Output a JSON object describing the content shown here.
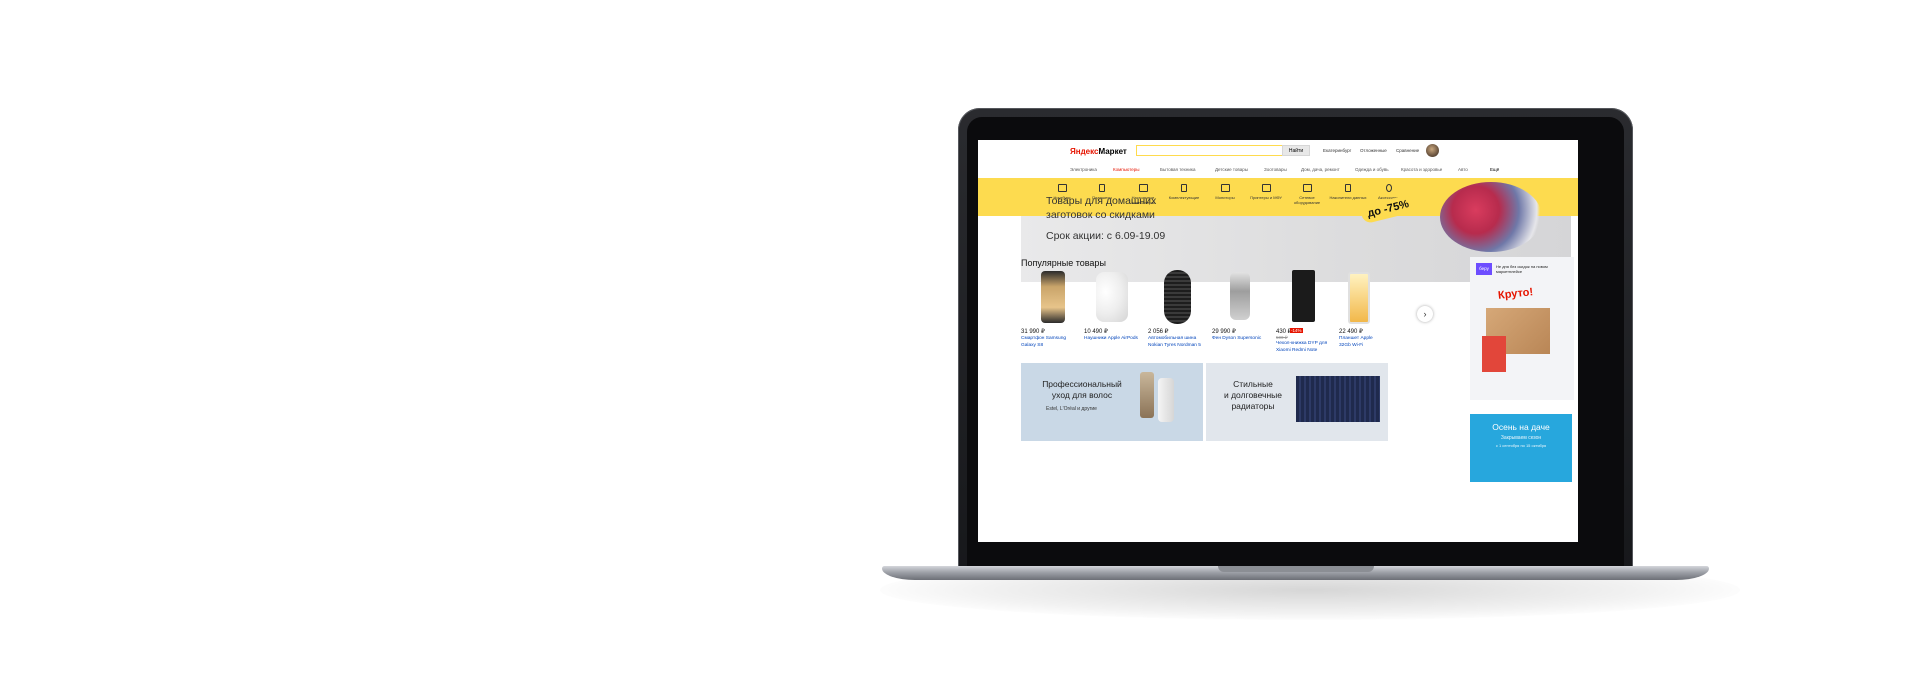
{
  "header": {
    "logo_y": "Яндекс",
    "logo_rest": "Маркет",
    "search_button": "Найти",
    "links": [
      "Екатеринбург",
      "Отложенные",
      "Сравнение"
    ]
  },
  "nav": {
    "items": [
      "Электроника",
      "Компьютеры",
      "Бытовая техника",
      "Детские товары",
      "Зоотовары",
      "Дом, дача, ремонт",
      "Одежда и обувь",
      "Красота и здоровье",
      "Авто",
      "Ещё"
    ]
  },
  "categories": {
    "items": [
      "Ноутбуки",
      "Планшеты",
      "Настольные компьютеры",
      "Комплектующие",
      "Мониторы",
      "Принтеры и МФУ",
      "Сетевое оборудование",
      "Накопители данных",
      "Аксессуары"
    ]
  },
  "banner": {
    "line1": "Товары для домашних",
    "line2": "заготовок со скидками",
    "dates": "Срок акции: с 6.09-19.09",
    "discount": "до -75%"
  },
  "popular": {
    "title": "Популярные товары",
    "products": [
      {
        "price": "31 990 ₽",
        "name": "Смартфон Samsung Galaxy S8"
      },
      {
        "price": "10 490 ₽",
        "name": "Наушники Apple AirPods"
      },
      {
        "price": "2 056 ₽",
        "name": "Автомобильная шина Nokian Tyres Nordman 5"
      },
      {
        "price": "29 990 ₽",
        "name": "Фен Dyson Supersonic"
      },
      {
        "price": "430 ₽",
        "old_price": "500 ₽",
        "discount": "-14%",
        "name": "Чехол-книжка DYP для Xiaomi Redmi Note"
      },
      {
        "price": "22 490 ₽",
        "name": "Планшет Apple 32Gb Wi-Fi"
      }
    ]
  },
  "side_ads": {
    "beru_logo": "беру",
    "beru_text": "Не дня без скидок на новом маркетплейсе",
    "beru_headline": "Круто!",
    "autumn_title": "Осень на даче",
    "autumn_sub": "Закрываем сезон",
    "autumn_dates": "с 1 сентября по 15 октября"
  },
  "promos": [
    {
      "title1": "Профессиональный",
      "title2": "уход для волос",
      "sub": "Estel, L'Oréal и другие"
    },
    {
      "title1": "Стильные",
      "title2": "и долговечные",
      "title3": "радиаторы"
    }
  ]
}
